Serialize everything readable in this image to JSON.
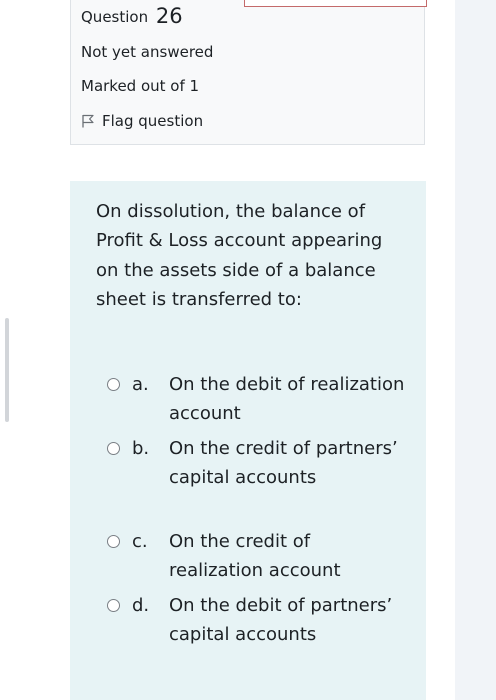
{
  "question_info": {
    "label": "Question",
    "number": "26",
    "status": "Not yet answered",
    "marks": "Marked out of 1",
    "flag_label": "Flag question"
  },
  "question": {
    "text": "On dissolution, the balance of Profit & Loss account appearing on the assets side of a balance sheet is transferred to:"
  },
  "answers": [
    {
      "letter": "a.",
      "text": "On the debit of realization account",
      "selected": false
    },
    {
      "letter": "b.",
      "text": "On the credit of partners’ capital accounts",
      "selected": false
    },
    {
      "letter": "c.",
      "text": "On the credit of realization account",
      "selected": false
    },
    {
      "letter": "d.",
      "text": "On the debit of partners’ capital accounts",
      "selected": false
    }
  ],
  "colors": {
    "info_background": "#f8f9fa",
    "content_background": "#e7f3f5",
    "text": "#1d2125",
    "radio_border": "#7a7f85"
  }
}
